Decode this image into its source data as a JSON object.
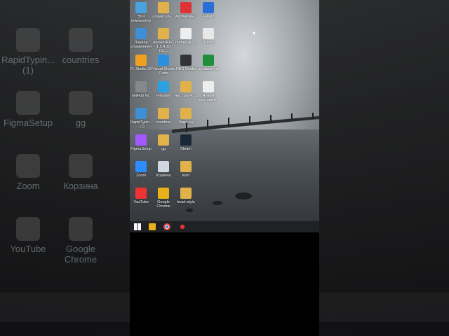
{
  "background_icons": [
    {
      "label": "RapidTypin...",
      "sub": "(1)"
    },
    {
      "label": "countries",
      "sub": ""
    },
    {
      "label": "FigmaSetup",
      "sub": ""
    },
    {
      "label": "gg",
      "sub": ""
    },
    {
      "label": "Zoom",
      "sub": ""
    },
    {
      "label": "Корзина",
      "sub": ""
    },
    {
      "label": "YouTube",
      "sub": ""
    },
    {
      "label": "Google",
      "sub": "Chrome"
    }
  ],
  "desktop_icons": [
    {
      "label": "Этот компьютер",
      "color": "#4aa3df"
    },
    {
      "label": "штамп.кль...",
      "color": "#e2b24a"
    },
    {
      "label": "ApowerREC",
      "color": "#d33"
    },
    {
      "label": "Fabalo",
      "color": "#2a6fd8"
    },
    {
      "label": "Панель управления",
      "color": "#3d8fd6"
    },
    {
      "label": "ApowerREC 1.5.4.10 (Sc...",
      "color": "#e2b24a"
    },
    {
      "label": "money glo...",
      "color": "#eee"
    },
    {
      "label": "iTunes",
      "color": "#e8e8e8"
    },
    {
      "label": "FL Studio 20",
      "color": "#f0a020"
    },
    {
      "label": "Visual Studio Code",
      "color": "#2b8fe0"
    },
    {
      "label": "OBS Studio",
      "color": "#333"
    },
    {
      "label": "незавлення",
      "color": "#1f8f3a"
    },
    {
      "label": "GitHub Inc",
      "color": "#888"
    },
    {
      "label": "Telegram",
      "color": "#2aa1e0"
    },
    {
      "label": "наст.расчо...",
      "color": "#e2b24a"
    },
    {
      "label": "Новый текстовый...",
      "color": "#eee"
    },
    {
      "label": "RapidTypin... (1)",
      "color": "#3d8fd6"
    },
    {
      "label": "countries",
      "color": "#e2b24a"
    },
    {
      "label": "flags-hu",
      "color": "#e2b24a"
    },
    {
      "label": "",
      "color": "transparent"
    },
    {
      "label": "FigmaSetup",
      "color": "#a259ff"
    },
    {
      "label": "gg",
      "color": "#e2b24a"
    },
    {
      "label": "Steam",
      "color": "#1b2838"
    },
    {
      "label": "",
      "color": "transparent"
    },
    {
      "label": "Zoom",
      "color": "#2d8cff"
    },
    {
      "label": "Корзина",
      "color": "#cfd8e0"
    },
    {
      "label": "todo",
      "color": "#e2b24a"
    },
    {
      "label": "",
      "color": "transparent"
    },
    {
      "label": "YouTube",
      "color": "#e33"
    },
    {
      "label": "Google Chrome",
      "color": "#e8b21a"
    },
    {
      "label": "heart-style",
      "color": "#e2b24a"
    }
  ],
  "taskbar": [
    {
      "name": "start-button",
      "icon": "windows-icon"
    },
    {
      "name": "store-button",
      "icon": "store-icon"
    },
    {
      "name": "chrome-button",
      "icon": "chrome-icon"
    },
    {
      "name": "recorder-button",
      "icon": "record-icon"
    }
  ]
}
